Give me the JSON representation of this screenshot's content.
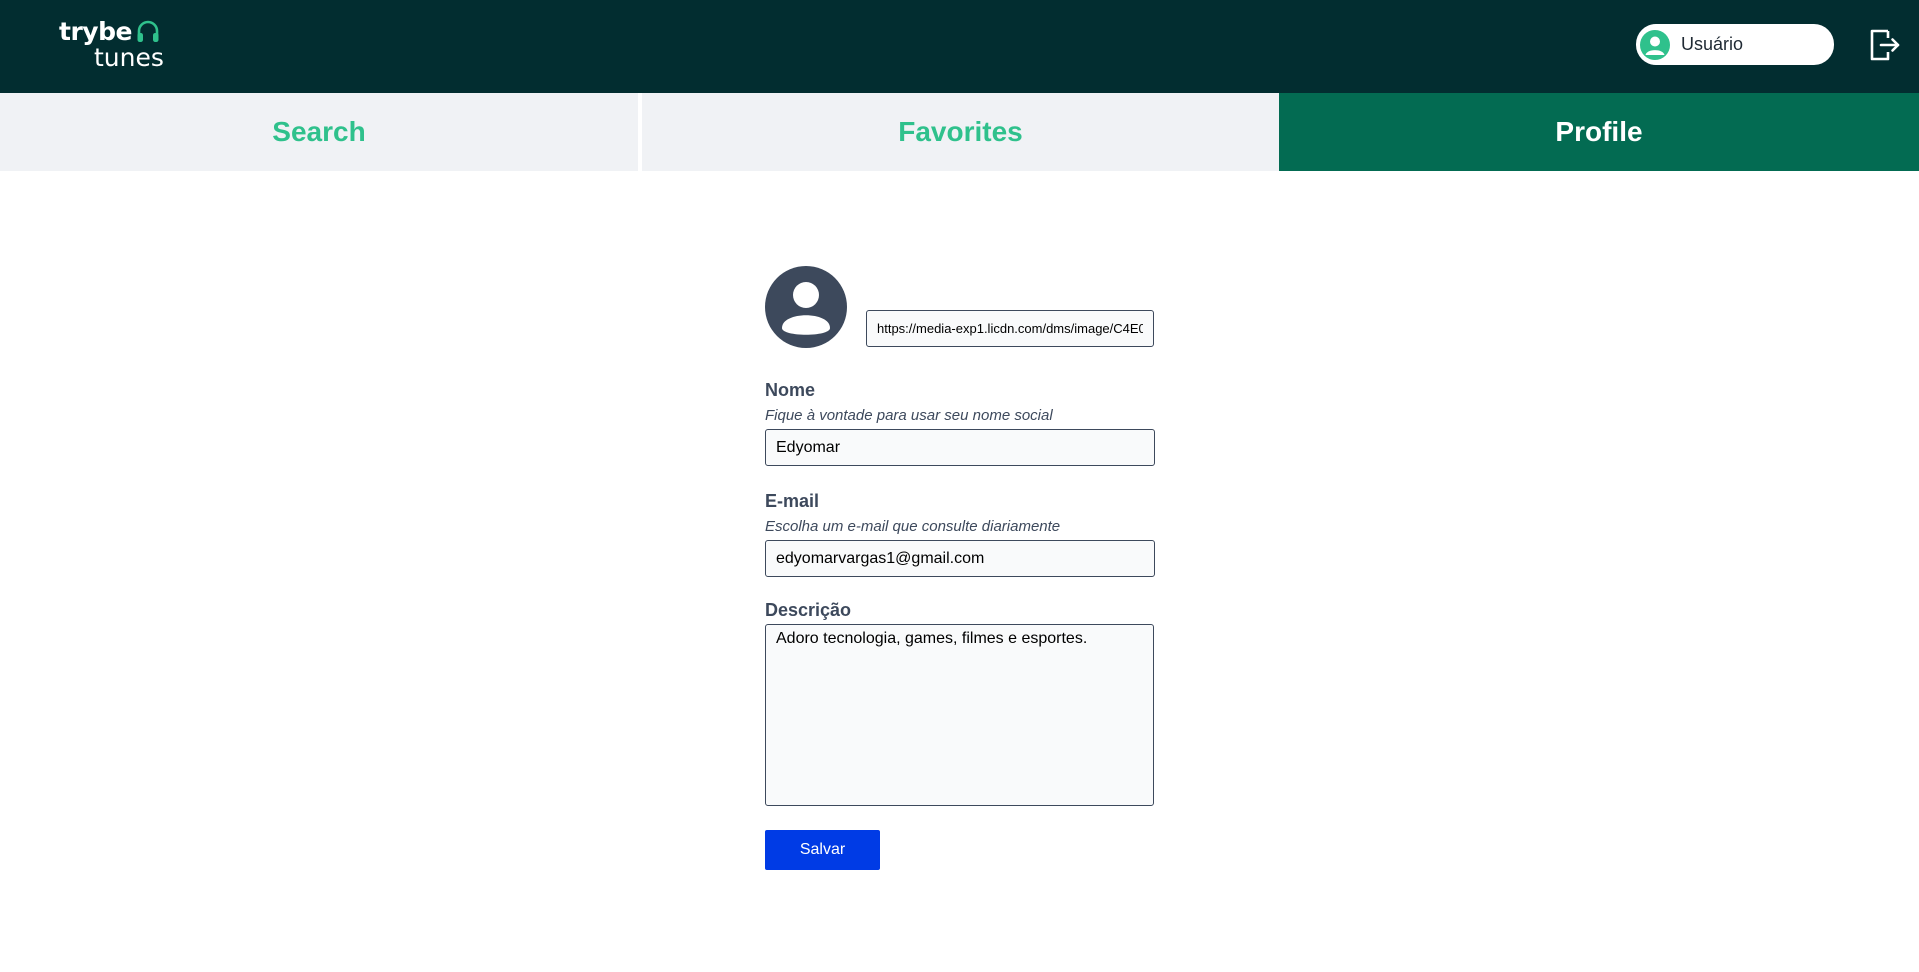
{
  "header": {
    "logo_line1": "trybe",
    "logo_line2": "tunes",
    "user_name": "Usuário",
    "logout_icon": "logout-icon",
    "colors": {
      "background": "#022d30",
      "accent": "#2fc18c"
    }
  },
  "tabs": [
    {
      "label": "Search",
      "active": false
    },
    {
      "label": "Favorites",
      "active": false
    },
    {
      "label": "Profile",
      "active": true
    }
  ],
  "profile": {
    "image_url": "https://media-exp1.licdn.com/dms/image/C4E0",
    "name_label": "Nome",
    "name_hint": "Fique à vontade para usar seu nome social",
    "name_value": "Edyomar",
    "email_label": "E-mail",
    "email_hint": "Escolha um e-mail que consulte diariamente",
    "email_value": "edyomarvargas1@gmail.com",
    "description_label": "Descrição",
    "description_value": "Adoro tecnologia, games, filmes e esportes.",
    "save_label": "Salvar"
  },
  "colors": {
    "active_tab": "#036b52",
    "inactive_tab_bg": "#f0f2f5",
    "inactive_tab_text": "#2fc18c",
    "save_button": "#003be5",
    "avatar": "#3d495c"
  }
}
